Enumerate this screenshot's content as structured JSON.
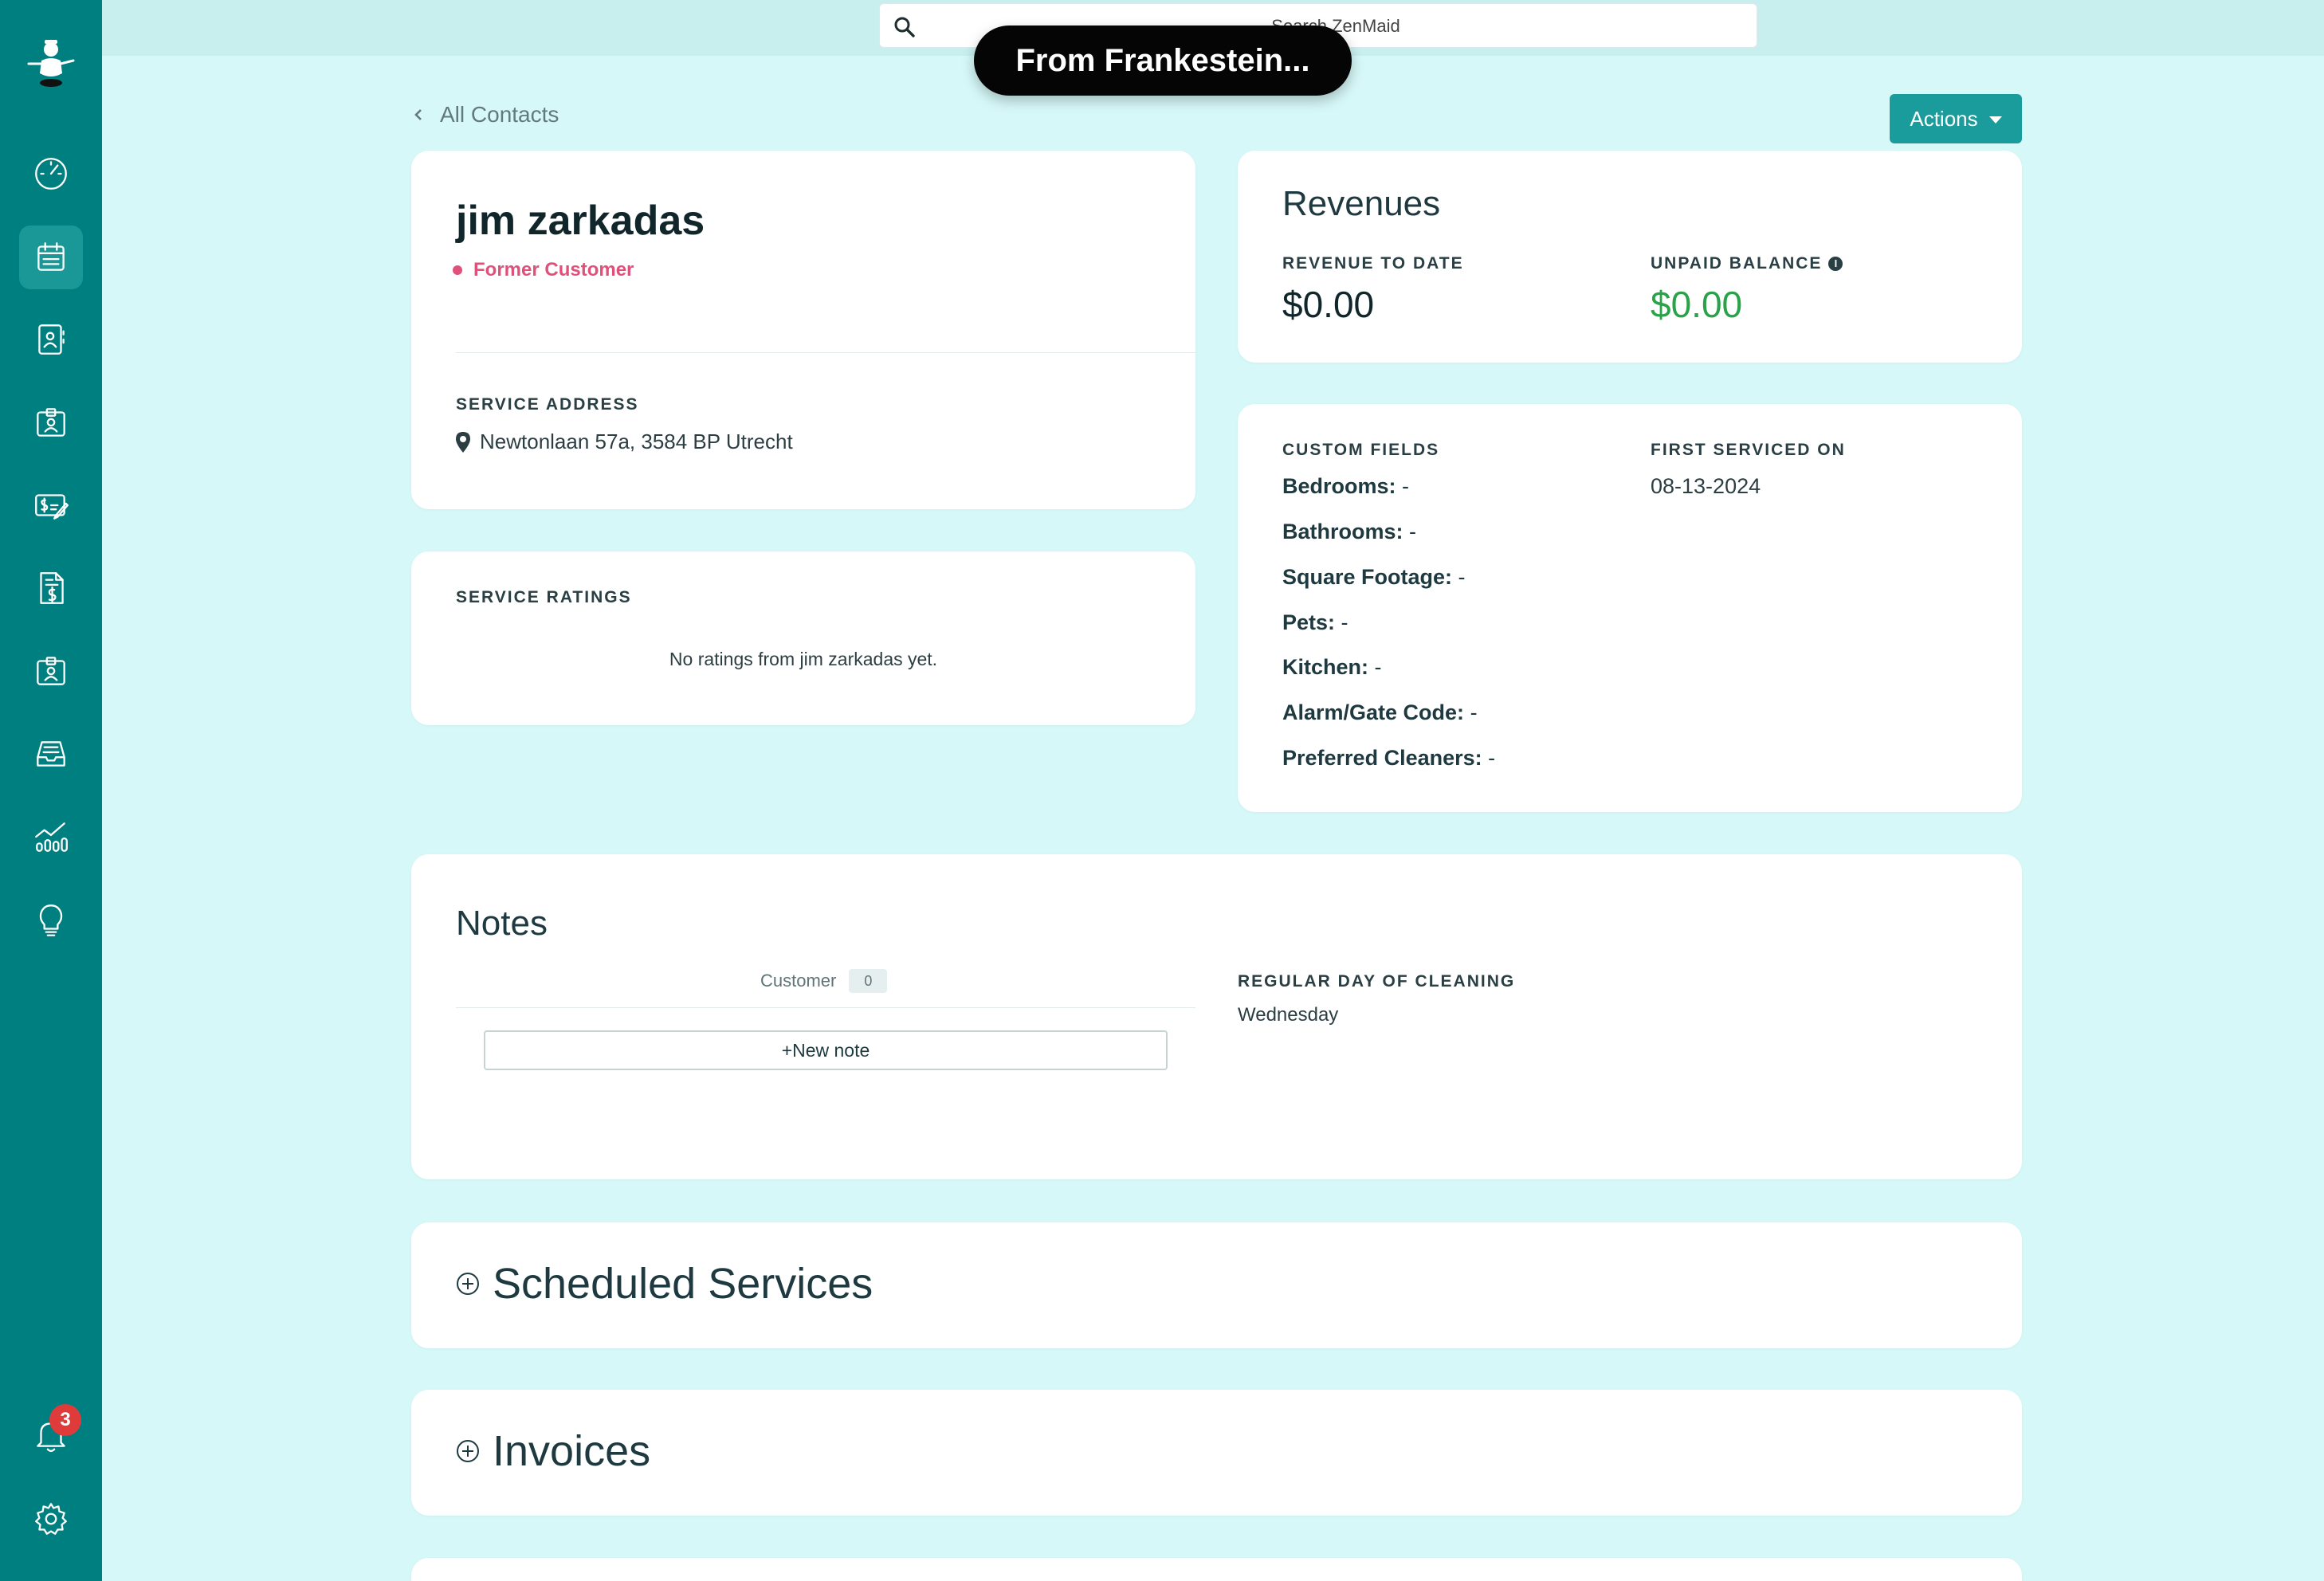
{
  "topbar": {
    "search_placeholder": "Search ZenMaid",
    "toast": "From Frankestein..."
  },
  "sidebar": {
    "items": [
      {
        "icon": "dashboard-icon"
      },
      {
        "icon": "calendar-icon",
        "active": true
      },
      {
        "icon": "contacts-icon"
      },
      {
        "icon": "employee-badge-icon"
      },
      {
        "icon": "pricing-icon"
      },
      {
        "icon": "invoice-icon"
      },
      {
        "icon": "employee-badge-icon"
      },
      {
        "icon": "inbox-icon"
      },
      {
        "icon": "reports-icon"
      },
      {
        "icon": "lightbulb-icon"
      }
    ],
    "notifications_count": "3"
  },
  "page": {
    "back_label": "All Contacts",
    "actions_label": "Actions"
  },
  "contact": {
    "name": "jim zarkadas",
    "status": "Former Customer",
    "status_color": "#e0507a",
    "service_address_label": "SERVICE ADDRESS",
    "service_address": "Newtonlaan 57a, 3584 BP Utrecht"
  },
  "ratings": {
    "label": "SERVICE RATINGS",
    "empty_text": "No ratings from jim zarkadas yet."
  },
  "revenues": {
    "title": "Revenues",
    "revenue_to_date_label": "REVENUE TO DATE",
    "revenue_to_date": "$0.00",
    "unpaid_balance_label": "UNPAID BALANCE",
    "unpaid_balance": "$0.00",
    "unpaid_color": "#2aa24a"
  },
  "custom_fields": {
    "label": "CUSTOM FIELDS",
    "fields": [
      {
        "name": "Bedrooms:",
        "value": " -"
      },
      {
        "name": "Bathrooms:",
        "value": " -"
      },
      {
        "name": "Square Footage:",
        "value": " -"
      },
      {
        "name": "Pets:",
        "value": " -"
      },
      {
        "name": "Kitchen:",
        "value": " -"
      },
      {
        "name": "Alarm/Gate Code:",
        "value": " -"
      },
      {
        "name": "Preferred Cleaners:",
        "value": " -"
      }
    ],
    "first_serviced_label": "FIRST SERVICED ON",
    "first_serviced": "08-13-2024"
  },
  "notes": {
    "title": "Notes",
    "tab_label": "Customer",
    "tab_count": "0",
    "new_note_label": "+New note",
    "regular_day_label": "REGULAR DAY OF CLEANING",
    "regular_day": "Wednesday"
  },
  "sections": {
    "scheduled_services": "Scheduled Services",
    "invoices": "Invoices"
  },
  "colors": {
    "sidebar": "#007f80",
    "background": "#d6f8f8",
    "accent": "#1b9c9c"
  }
}
